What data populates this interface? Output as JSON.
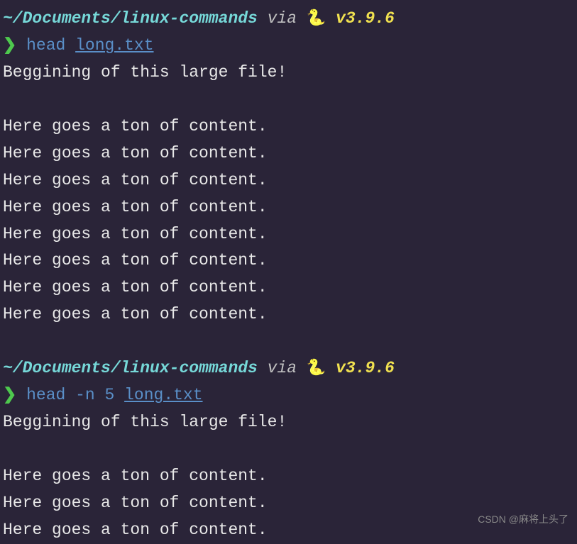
{
  "block1": {
    "path": "~/Documents/linux-commands",
    "via": " via ",
    "snake_icon": "🐍",
    "version": " v3.9.6",
    "prompt_arrow": "❯",
    "command": " head ",
    "filename": "long.txt",
    "output": [
      "Beggining of this large file!",
      "",
      "Here goes a ton of content.",
      "Here goes a ton of content.",
      "Here goes a ton of content.",
      "Here goes a ton of content.",
      "Here goes a ton of content.",
      "Here goes a ton of content.",
      "Here goes a ton of content.",
      "Here goes a ton of content."
    ]
  },
  "block2": {
    "path": "~/Documents/linux-commands",
    "via": " via ",
    "snake_icon": "🐍",
    "version": " v3.9.6",
    "prompt_arrow": "❯",
    "command": " head -n 5 ",
    "filename": "long.txt",
    "output": [
      "Beggining of this large file!",
      "",
      "Here goes a ton of content.",
      "Here goes a ton of content.",
      "Here goes a ton of content."
    ]
  },
  "watermark": "CSDN @麻将上头了"
}
